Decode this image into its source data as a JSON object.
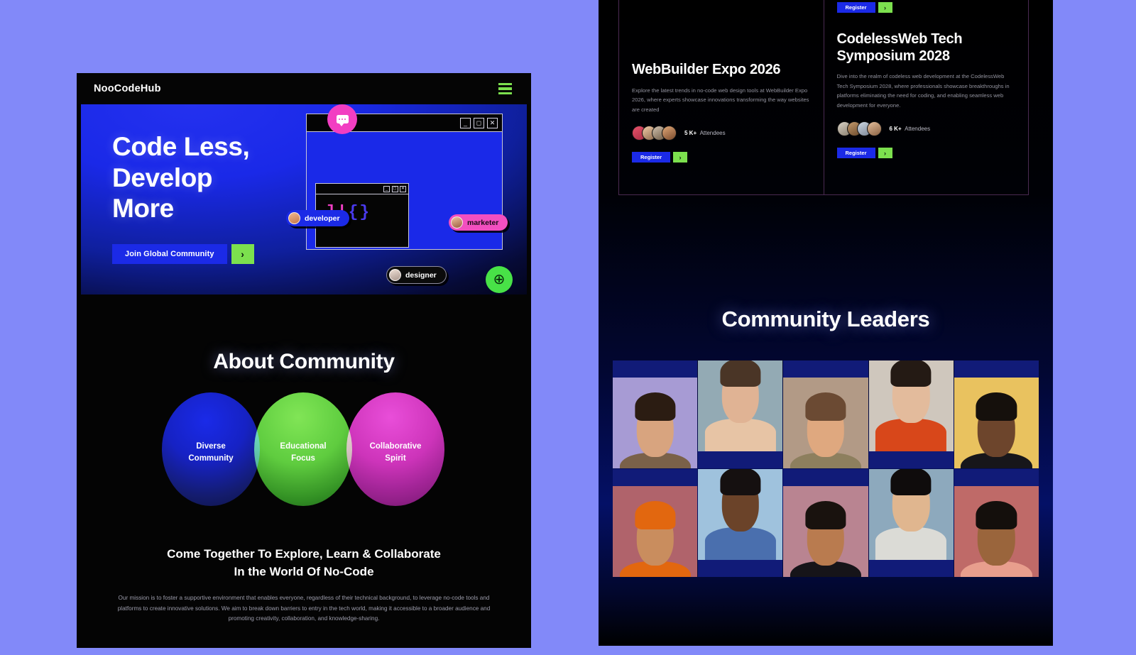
{
  "page": {
    "background_color": "#8289f9"
  },
  "left_panel": {
    "navbar": {
      "brand": "NooCodeHub",
      "menu_icon": "hamburger-icon"
    },
    "hero": {
      "title": "Code Less,\nDevelop\nMore",
      "cta_label": "Join Global Community",
      "cta_arrow": "›",
      "chips": [
        {
          "label": "developer",
          "color": "#1b2ae7"
        },
        {
          "label": "marketer",
          "color": "#f24fc0"
        },
        {
          "label": "designer",
          "color": "#0b0b0b"
        }
      ],
      "code_glyph_left": "]|",
      "code_glyph_right": "{}",
      "globe_icon": "⊕",
      "window_buttons": [
        "—",
        "□",
        "✕"
      ]
    },
    "about": {
      "title": "About Community",
      "venn": [
        {
          "label": "Diverse\nCommunity",
          "color": "#1a2ae8"
        },
        {
          "label": "Educational\nFocus",
          "color": "#5ccb3c"
        },
        {
          "label": "Collaborative\nSpirit",
          "color": "#cc31b9"
        }
      ],
      "mission_heading": "Come Together To Explore, Learn & Collaborate\nIn the World Of No-Code",
      "mission_body": "Our mission is to foster a supportive environment that enables everyone, regardless of their technical background, to leverage no-code tools and platforms to create innovative solutions. We aim to break down barriers to entry in the tech world, making it accessible to a broader audience and promoting creativity, collaboration, and knowledge-sharing."
    }
  },
  "right_panel": {
    "events": [
      {
        "title": "WebBuilder Expo 2026",
        "description": "Explore the latest trends in no-code web design tools at WebBuilder Expo 2026, where experts showcase innovations transforming the way websites are created",
        "attendee_count": "5 K+",
        "attendee_label": "Attendees",
        "register_label": "Register",
        "register_arrow": "›"
      },
      {
        "title": "CodelessWeb Tech Symposium 2028",
        "description": "Dive into the realm of codeless web development at the CodelessWeb Tech Symposium 2028, where professionals showcase breakthroughs in platforms eliminating the need for coding, and enabling seamless web development for everyone.",
        "attendee_count": "6 K+",
        "attendee_label": "Attendees",
        "register_label": "Register",
        "register_arrow": "›"
      }
    ],
    "leaders": {
      "title": "Community Leaders",
      "portraits": [
        {
          "bg": "#a79bd4",
          "skin": "#d8a47f",
          "hair": "#2b1c12",
          "shirt": "#7a6149",
          "offset": "down"
        },
        {
          "bg": "#93aab4",
          "skin": "#e0b394",
          "hair": "#4a3526",
          "shirt": "#e7c4a5",
          "offset": "up"
        },
        {
          "bg": "#b29a86",
          "skin": "#dfa87f",
          "hair": "#6b4a33",
          "shirt": "#8d7f5e",
          "offset": "down"
        },
        {
          "bg": "#cfc7bd",
          "skin": "#e3bb9c",
          "hair": "#241a14",
          "shirt": "#d8471a",
          "offset": "up"
        },
        {
          "bg": "#e9c25f",
          "skin": "#6d452c",
          "hair": "#15100c",
          "shirt": "#17161a",
          "offset": "down"
        },
        {
          "bg": "#b0636b",
          "skin": "#c98d5e",
          "hair": "#e2670f",
          "shirt": "#e2670f",
          "offset": "down"
        },
        {
          "bg": "#9fc2dd",
          "skin": "#6b4329",
          "hair": "#151010",
          "shirt": "#4a6fae",
          "offset": "up"
        },
        {
          "bg": "#b98491",
          "skin": "#b97b4f",
          "hair": "#19120e",
          "shirt": "#161419",
          "offset": "down"
        },
        {
          "bg": "#8da9bd",
          "skin": "#e0b68f",
          "hair": "#0f0c0c",
          "shirt": "#dbdbd6",
          "offset": "up"
        },
        {
          "bg": "#bf6a68",
          "skin": "#9a653c",
          "hair": "#140f0c",
          "shirt": "#e89e8d",
          "offset": "down"
        }
      ]
    }
  }
}
